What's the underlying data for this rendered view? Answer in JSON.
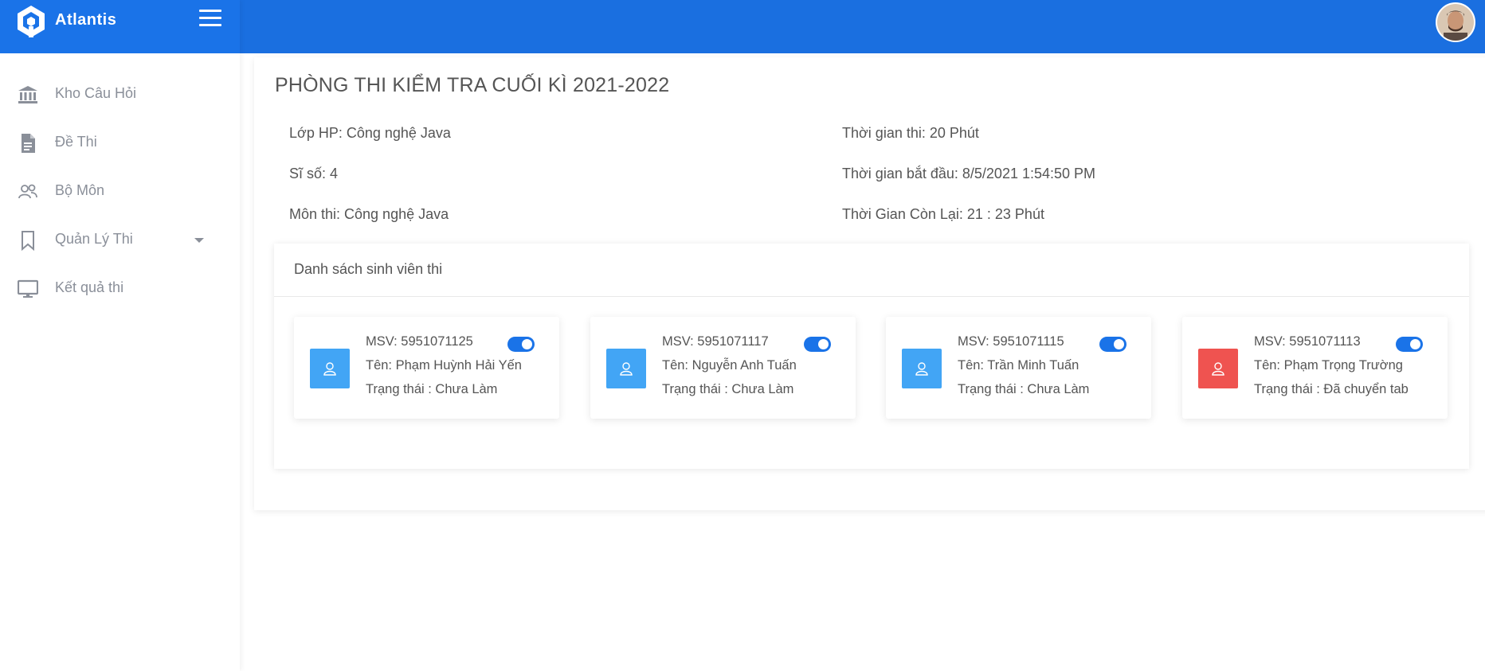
{
  "app": {
    "name": "Atlantis",
    "accent_color": "#1a73e8"
  },
  "sidebar": {
    "items": [
      {
        "label": "Kho Câu Hỏi",
        "icon": "bank-icon"
      },
      {
        "label": "Đề Thi",
        "icon": "document-icon"
      },
      {
        "label": "Bộ Môn",
        "icon": "users-icon"
      },
      {
        "label": "Quản Lý Thi",
        "icon": "bookmark-icon",
        "has_dropdown": true
      },
      {
        "label": "Kết quả thi",
        "icon": "monitor-icon"
      }
    ]
  },
  "page": {
    "title": "PHÒNG THI KIỂM TRA CUỐI KÌ 2021-2022",
    "info": {
      "class": "Lớp HP: Công nghệ Java",
      "count": "Sĩ số: 4",
      "subject": "Môn thi: Công nghệ Java",
      "duration": "Thời gian thi: 20 Phút",
      "start": "Thời gian bắt đầu: 8/5/2021 1:54:50 PM",
      "remaining": "Thời Gian Còn Lại: 21 : 23 Phút"
    }
  },
  "student_list": {
    "title": "Danh sách sinh viên thi",
    "students": [
      {
        "msv": "MSV: 5951071125",
        "name": "Tên: Phạm Huỳnh Hải Yến",
        "status": "Trạng thái : Chưa Làm",
        "color": "#42a5f5",
        "toggle_on": true
      },
      {
        "msv": "MSV: 5951071117",
        "name": "Tên: Nguyễn Anh Tuấn",
        "status": "Trạng thái : Chưa Làm",
        "color": "#42a5f5",
        "toggle_on": true
      },
      {
        "msv": "MSV: 5951071115",
        "name": "Tên: Trần Minh Tuấn",
        "status": "Trạng thái : Chưa Làm",
        "color": "#42a5f5",
        "toggle_on": true
      },
      {
        "msv": "MSV: 5951071113",
        "name": "Tên: Phạm Trọng Trường",
        "status": "Trạng thái : Đã chuyển tab",
        "color": "#ef5350",
        "toggle_on": true
      }
    ]
  }
}
